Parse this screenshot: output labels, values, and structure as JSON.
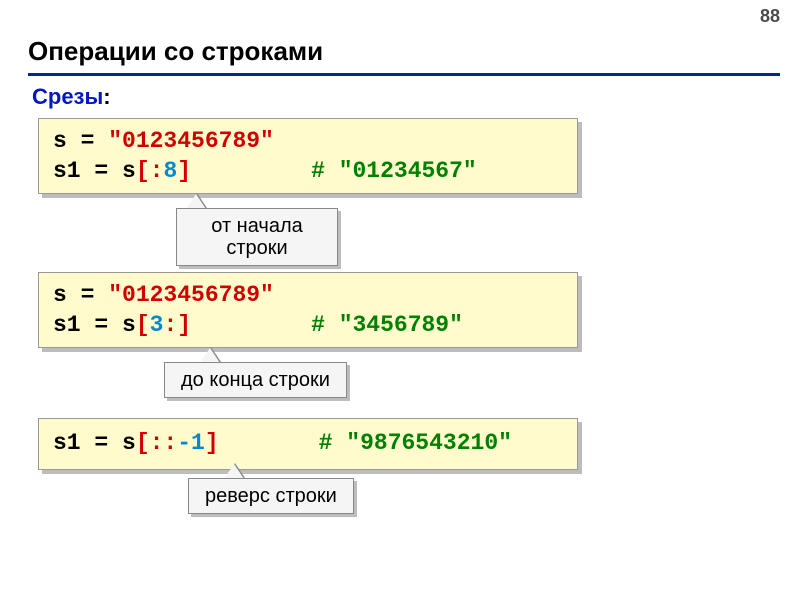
{
  "page_number": "88",
  "title": "Операции со строками",
  "subtitle": "Срезы",
  "subtitle_colon": ":",
  "block1": {
    "line1_a": "s = ",
    "line1_b": "\"0123456789\"",
    "line2_a": "s1 = s",
    "line2_b": "[:",
    "line2_c": "8",
    "line2_d": "]",
    "comment_hash": "#",
    "comment_text": "\"01234567\""
  },
  "callout1": "от начала строки",
  "block2": {
    "line1_a": "s = ",
    "line1_b": "\"0123456789\"",
    "line2_a": "s1 = s",
    "line2_b": "[",
    "line2_c": "3",
    "line2_d": ":]",
    "comment_hash": "#",
    "comment_text": "\"3456789\""
  },
  "callout2": "до конца строки",
  "block3": {
    "line_a": "s1 =  s",
    "line_b": "[::",
    "line_c": "-1",
    "line_d": "]",
    "comment_hash": "#",
    "comment_text": "\"9876543210\""
  },
  "callout3": "реверс строки"
}
